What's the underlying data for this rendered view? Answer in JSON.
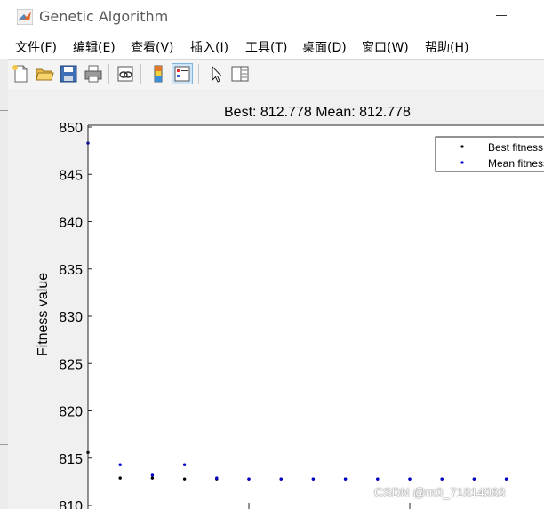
{
  "window": {
    "title": "Genetic Algorithm",
    "icon": "matlab-logo-icon"
  },
  "menu": [
    {
      "label": "文件(F)"
    },
    {
      "label": "编辑(E)"
    },
    {
      "label": "查看(V)"
    },
    {
      "label": "插入(I)"
    },
    {
      "label": "工具(T)"
    },
    {
      "label": "桌面(D)"
    },
    {
      "label": "窗口(W)"
    },
    {
      "label": "帮助(H)"
    }
  ],
  "toolbar": [
    {
      "icon": "new-figure-icon"
    },
    {
      "icon": "open-file-icon"
    },
    {
      "icon": "save-icon"
    },
    {
      "icon": "print-icon"
    },
    {
      "icon": "link-plot-icon"
    },
    {
      "icon": "colorbar-icon"
    },
    {
      "icon": "legend-icon"
    },
    {
      "icon": "pointer-icon"
    },
    {
      "icon": "property-editor-icon"
    }
  ],
  "colors": {
    "best": "#000000",
    "mean": "#0000cc",
    "axes_bg": "#ffffff"
  },
  "watermark": "CSDN @m0_71814083",
  "chart_data": {
    "type": "scatter",
    "title": "Best: 812.778 Mean: 812.778",
    "xlabel": "",
    "ylabel": "Fitness value",
    "ylim": [
      810,
      850
    ],
    "xlim": [
      1,
      15
    ],
    "yticks": [
      810,
      815,
      820,
      825,
      830,
      835,
      840,
      845,
      850
    ],
    "xticks": [
      6,
      11
    ],
    "grid": false,
    "legend_position": "top-right",
    "series": [
      {
        "name": "Best fitness",
        "marker": "dot",
        "color": "#000000",
        "x": [
          1,
          2,
          3,
          4,
          5,
          6,
          7,
          8,
          9,
          10,
          11,
          12,
          13,
          14
        ],
        "y": [
          815.6,
          812.9,
          812.9,
          812.8,
          812.8,
          812.8,
          812.8,
          812.8,
          812.8,
          812.8,
          812.8,
          812.8,
          812.8,
          812.8
        ]
      },
      {
        "name": "Mean fitness",
        "marker": "dot",
        "color": "#0000cc",
        "x": [
          1,
          2,
          3,
          4,
          5,
          6,
          7,
          8,
          9,
          10,
          11,
          12,
          13,
          14
        ],
        "y": [
          848.3,
          814.3,
          813.2,
          814.3,
          812.9,
          812.8,
          812.8,
          812.8,
          812.8,
          812.8,
          812.8,
          812.8,
          812.8,
          812.8
        ]
      }
    ]
  }
}
